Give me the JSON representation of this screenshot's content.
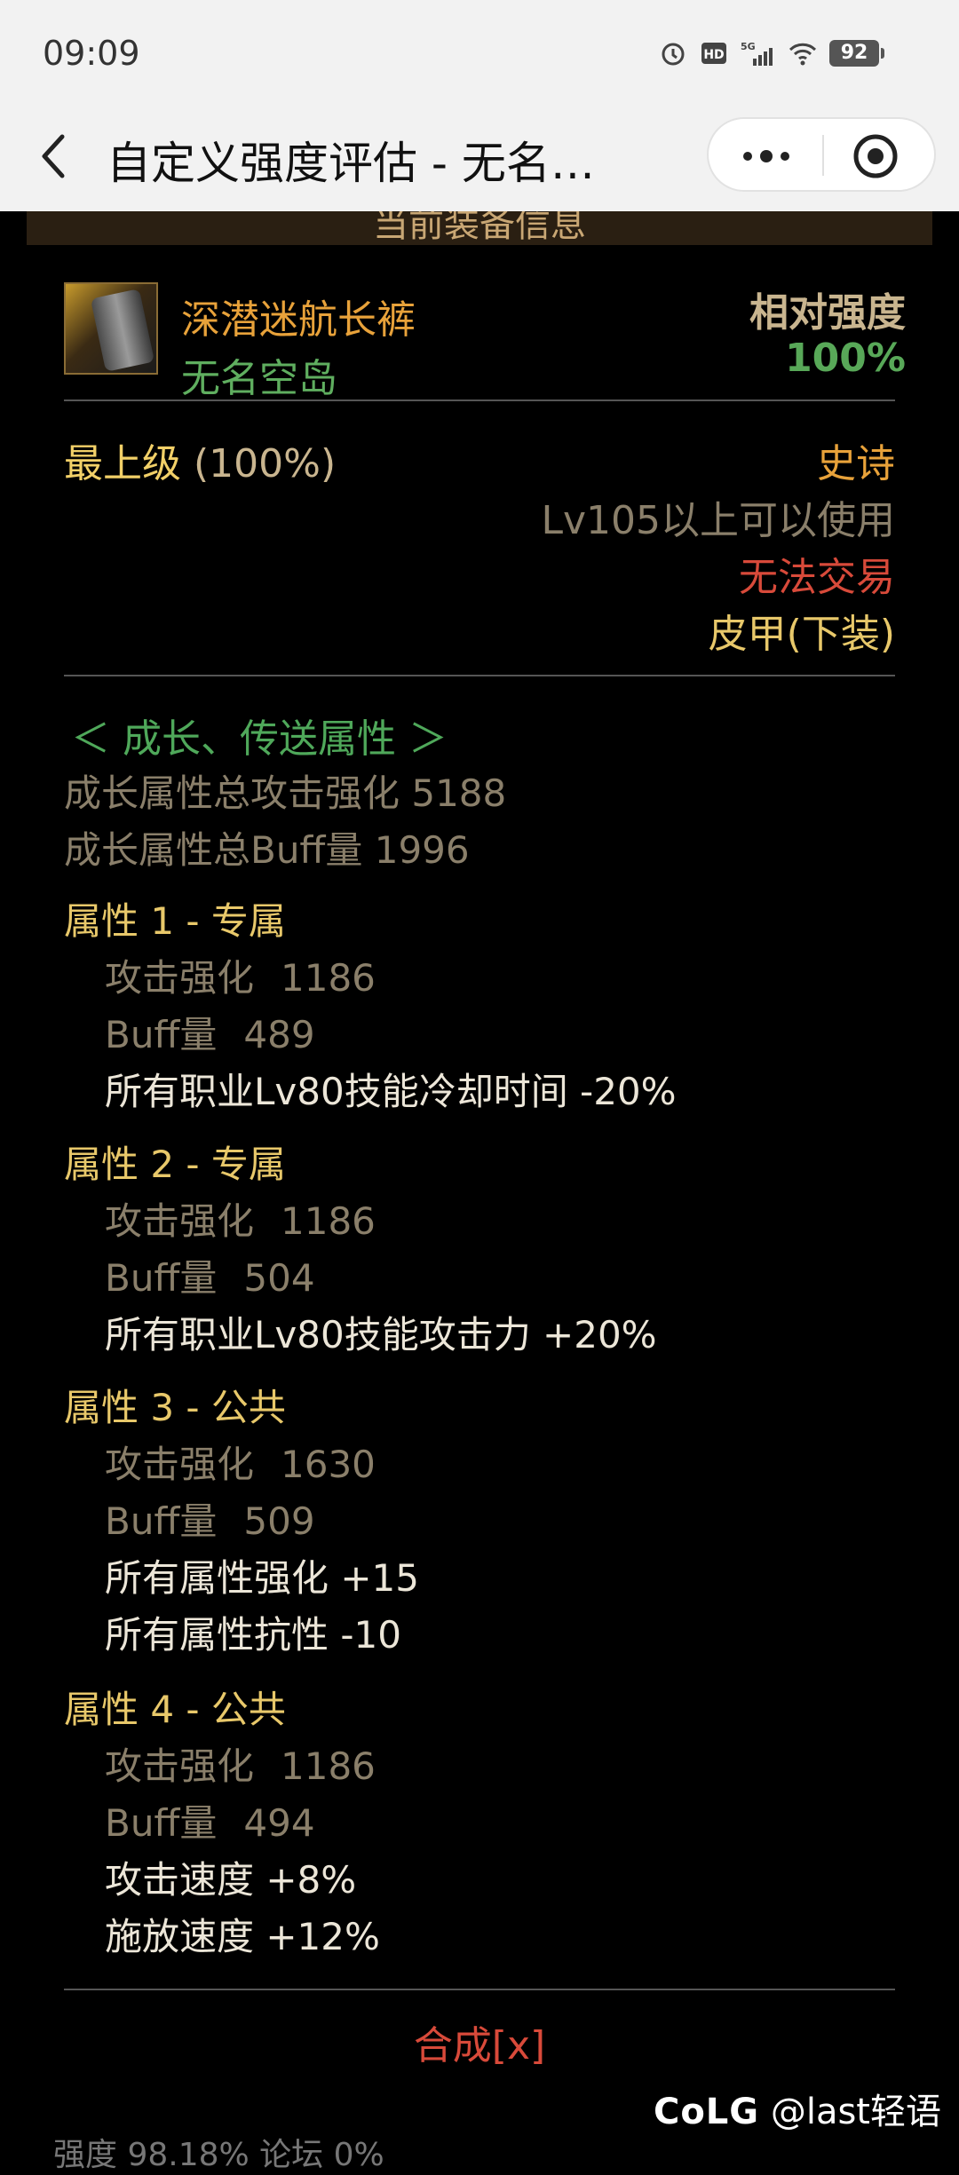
{
  "status_bar": {
    "time": "09:09",
    "network": "5G",
    "battery": "92"
  },
  "titlebar": {
    "title": "自定义强度评估 - 无名…"
  },
  "content": {
    "header": "当前装备信息",
    "item": {
      "name": "深潜迷航长裤",
      "set_name": "无名空岛",
      "relative_strength_label": "相对强度",
      "relative_strength_value": "100%"
    },
    "grade": {
      "label": "最上级",
      "percent": "(100%)"
    },
    "info": {
      "rarity": "史诗",
      "level_req": "Lv105以上可以使用",
      "trade": "无法交易",
      "slot": "皮甲(下装)"
    },
    "growth": {
      "title": "＜ 成长、传送属性 ＞",
      "total_attack": "成长属性总攻击强化 5188",
      "total_buff": "成长属性总Buff量 1996",
      "attrs": [
        {
          "header": "属性 1 - 专属",
          "atk_label": "攻击强化",
          "atk_value": "1186",
          "buff_label": "Buff量",
          "buff_value": "489",
          "effects": [
            "所有职业Lv80技能冷却时间 -20%"
          ]
        },
        {
          "header": "属性 2 - 专属",
          "atk_label": "攻击强化",
          "atk_value": "1186",
          "buff_label": "Buff量",
          "buff_value": "504",
          "effects": [
            "所有职业Lv80技能攻击力 +20%"
          ]
        },
        {
          "header": "属性 3 - 公共",
          "atk_label": "攻击强化",
          "atk_value": "1630",
          "buff_label": "Buff量",
          "buff_value": "509",
          "effects": [
            "所有属性强化 +15",
            "所有属性抗性 -10"
          ]
        },
        {
          "header": "属性 4 - 公共",
          "atk_label": "攻击强化",
          "atk_value": "1186",
          "buff_label": "Buff量",
          "buff_value": "494",
          "effects": [
            "攻击速度 +8%",
            "施放速度 +12%"
          ]
        }
      ]
    },
    "synth": "合成[x]",
    "watermark_handle": "@last轻语",
    "bottom_partial": "强度 98.18%                论坛 0%"
  }
}
